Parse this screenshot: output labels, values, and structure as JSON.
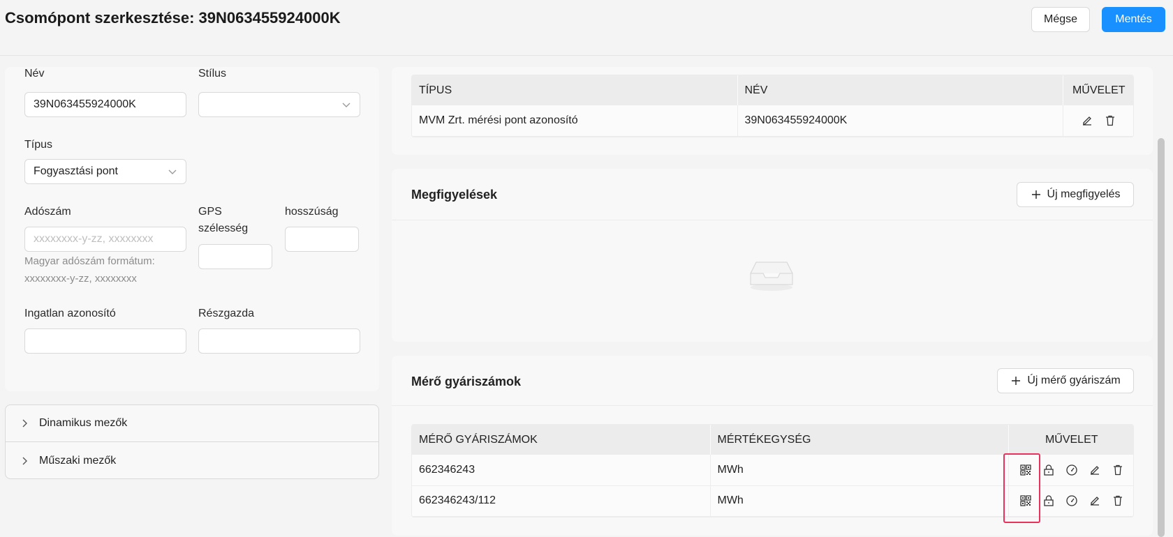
{
  "header": {
    "title": "Csomópont szerkesztése: 39N063455924000K",
    "cancel_label": "Mégse",
    "save_label": "Mentés"
  },
  "form": {
    "name_label": "Név",
    "name_value": "39N063455924000K",
    "style_label": "Stílus",
    "style_value": "",
    "type_label": "Típus",
    "type_value": "Fogyasztási pont",
    "tax_label": "Adószám",
    "tax_placeholder": "xxxxxxxx-y-zz, xxxxxxxx",
    "tax_hint_line1": "Magyar adószám formátum:",
    "tax_hint_line2": "xxxxxxxx-y-zz, xxxxxxxx",
    "gps_lat_label_line1": "GPS",
    "gps_lat_label_line2": "szélesség",
    "gps_lat_value": "",
    "gps_lon_label": "hosszúság",
    "gps_lon_value": "",
    "property_label": "Ingatlan azonosító",
    "property_value": "",
    "subowner_label": "Részgazda",
    "subowner_value": ""
  },
  "collapses": [
    {
      "label": "Dinamikus mezők"
    },
    {
      "label": "Műszaki mezők"
    }
  ],
  "identifiers": {
    "columns": [
      "TÍPUS",
      "NÉV",
      "MŰVELET"
    ],
    "rows": [
      {
        "type": "MVM Zrt. mérési pont azonosító",
        "name": "39N063455924000K"
      }
    ]
  },
  "observations": {
    "title": "Megfigyelések",
    "add_label": "Új megfigyelés"
  },
  "meters": {
    "title": "Mérő gyáriszámok",
    "add_label": "Új mérő gyáriszám",
    "columns": [
      "MÉRŐ GYÁRISZÁMOK",
      "MÉRTÉKEGYSÉG",
      "MŰVELET"
    ],
    "rows": [
      {
        "serial": "662346243",
        "unit": "MWh"
      },
      {
        "serial": "662346243/112",
        "unit": "MWh"
      }
    ]
  },
  "colors": {
    "primary": "#1890ff",
    "highlight": "#e8315b"
  }
}
